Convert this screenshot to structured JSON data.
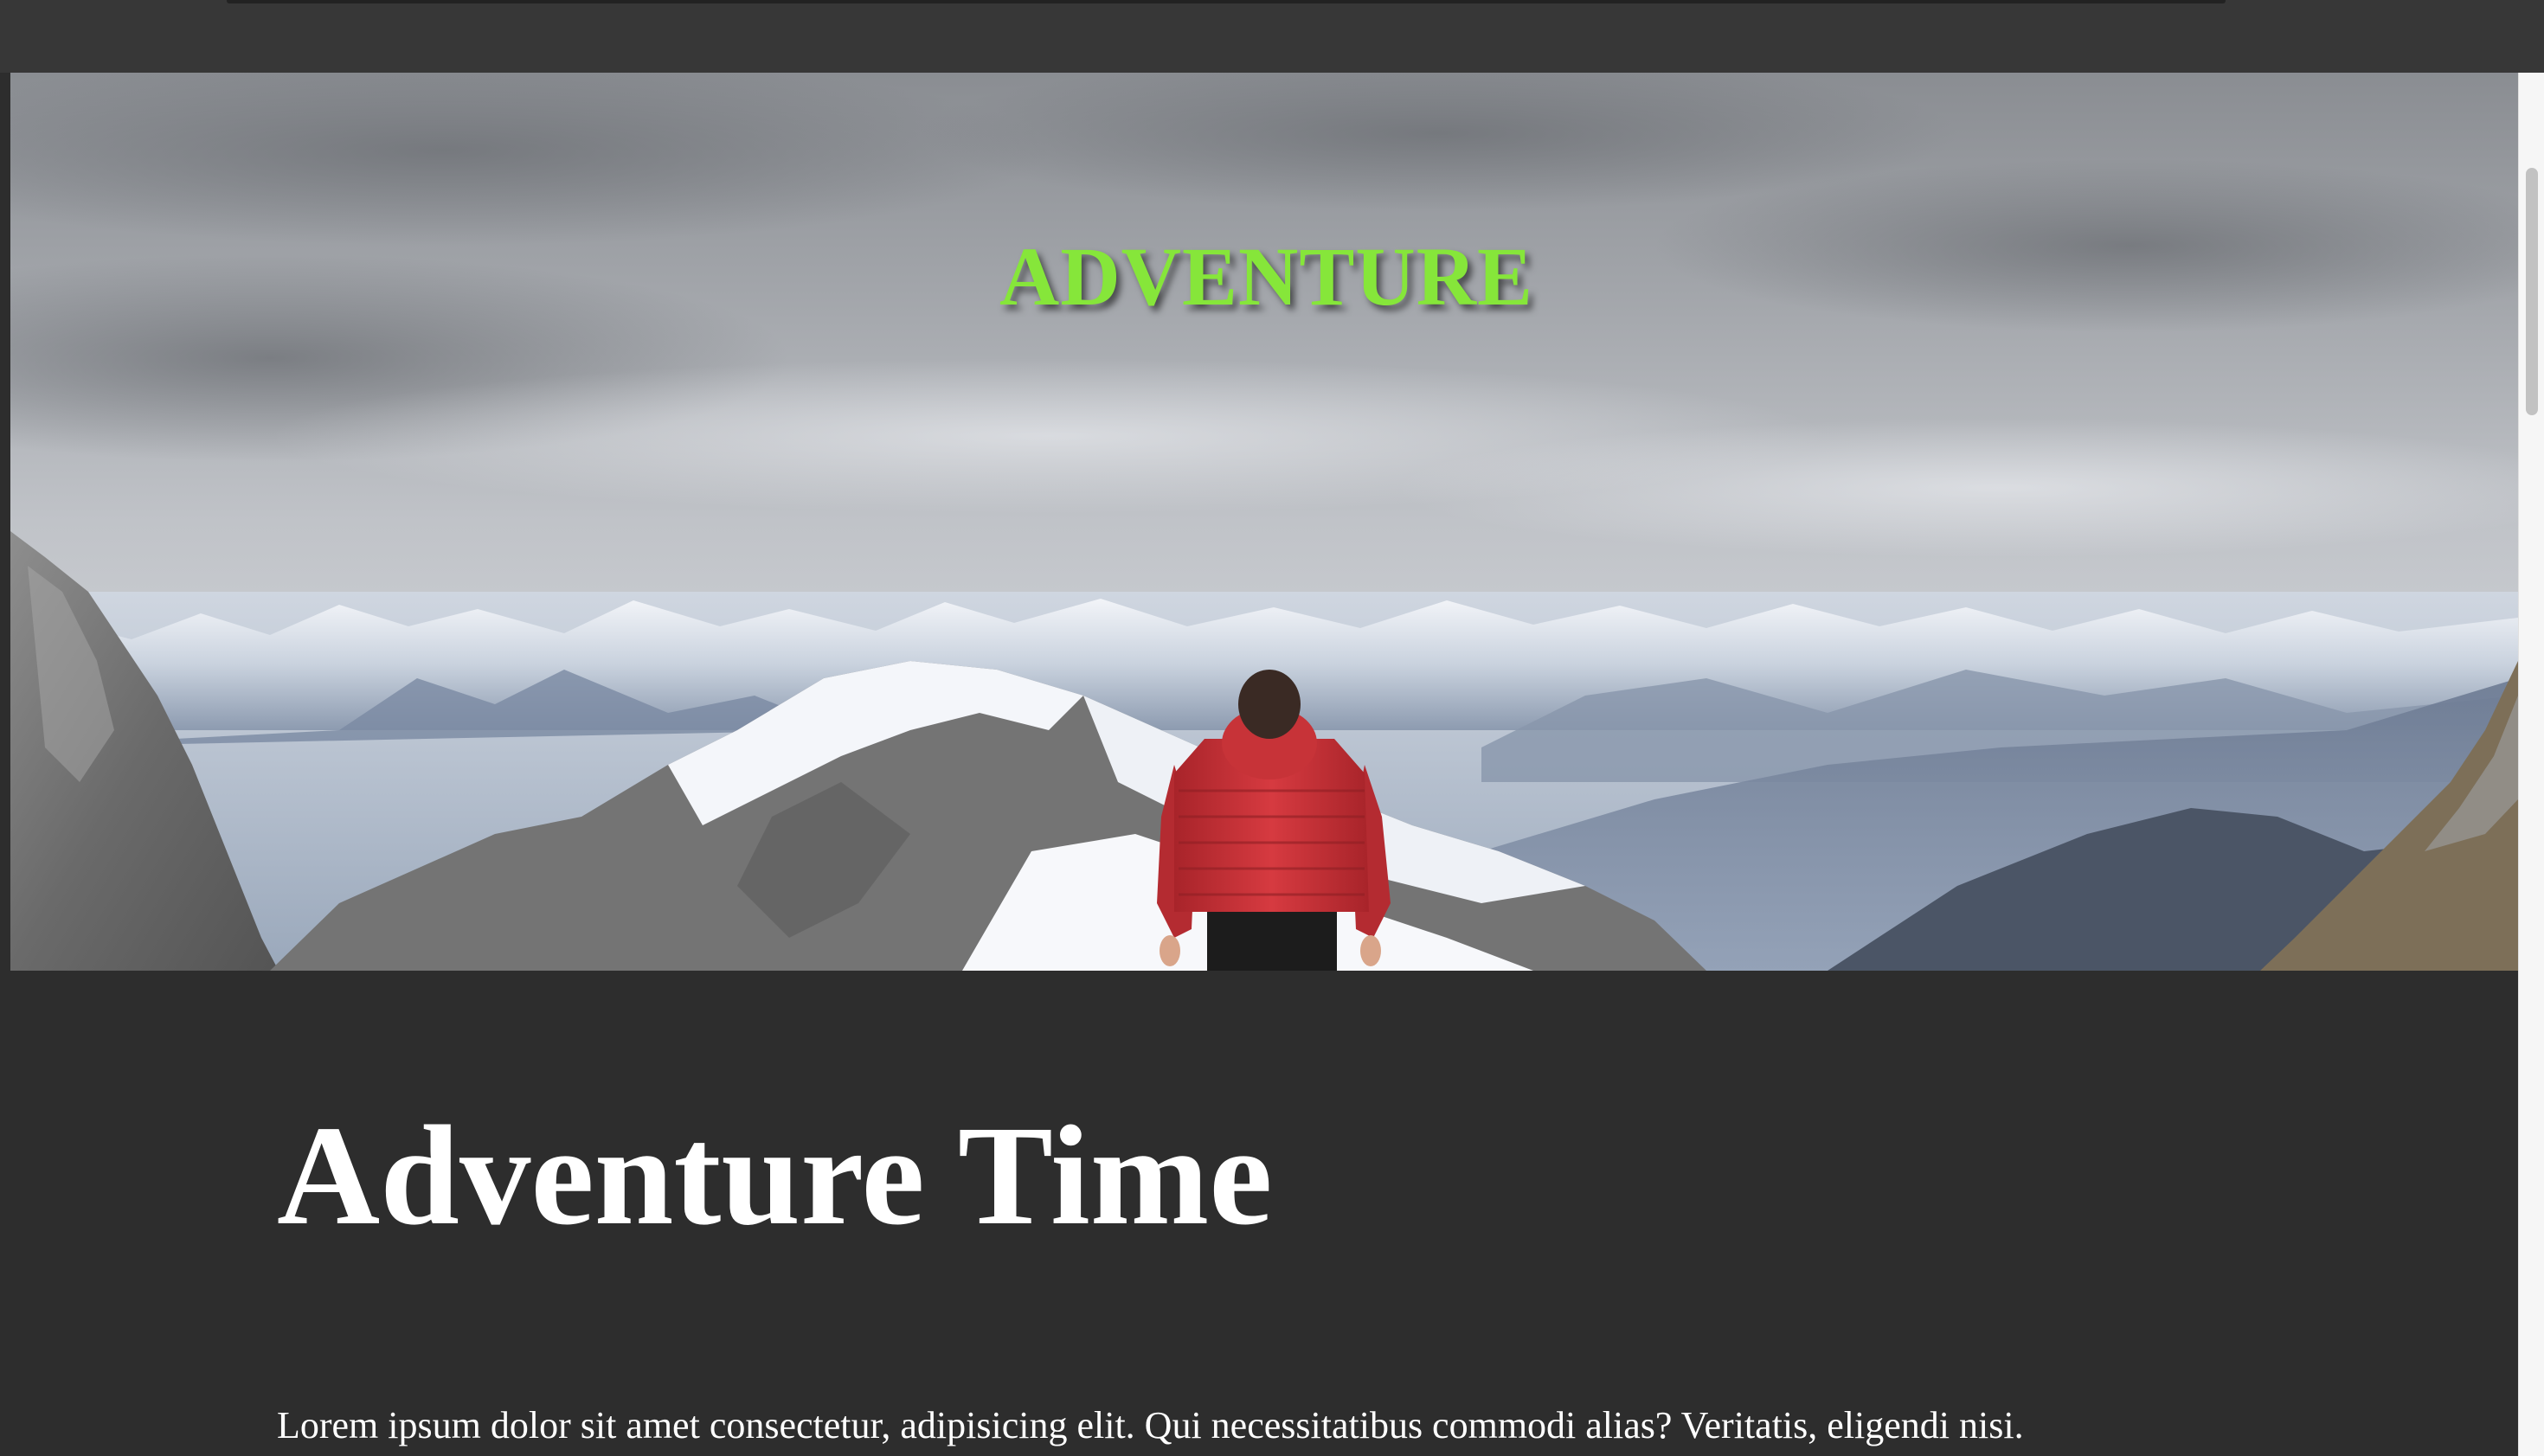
{
  "hero": {
    "title": "ADVENTURE",
    "title_color": "#86e63a",
    "image_description_icon": "mountain-hiker-photo"
  },
  "main": {
    "heading": "Adventure Time",
    "paragraph": "Lorem ipsum dolor sit amet consectetur, adipisicing elit. Qui necessitatibus commodi alias? Veritatis, eligendi nisi."
  },
  "colors": {
    "background": "#2d2d2d",
    "top_bar": "#373737",
    "text": "#ffffff",
    "jacket": "#c8343a"
  }
}
